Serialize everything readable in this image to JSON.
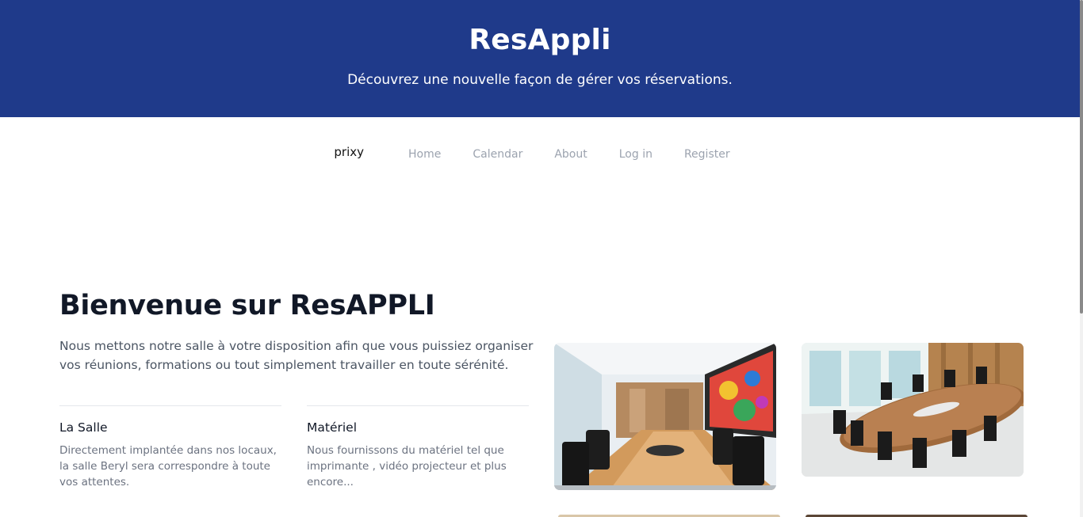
{
  "hero": {
    "title": "ResAppli",
    "subtitle": "Découvrez une nouvelle façon de gérer vos réservations.",
    "background_color": "#1f3a8a"
  },
  "nav": {
    "brand": "prixy",
    "links": [
      "Home",
      "Calendar",
      "About",
      "Log in",
      "Register"
    ]
  },
  "welcome": {
    "title": "Bienvenue sur ResAPPLI",
    "text": "Nous mettons notre salle à votre disposition afin que vous puissiez organiser vos réunions, formations ou tout simplement travailler en toute sérénité."
  },
  "features": [
    {
      "title": "La Salle",
      "text": "Directement implantée dans nos locaux, la salle Beryl sera correspondre à toute vos attentes."
    },
    {
      "title": "Matériel",
      "text": "Nous fournissons du matériel tel que imprimante , vidéo projecteur et plus encore..."
    }
  ],
  "gallery": {
    "images": [
      "conference-room-photo",
      "meeting-room-oval-table-photo",
      "room-photo",
      "room-photo"
    ]
  }
}
